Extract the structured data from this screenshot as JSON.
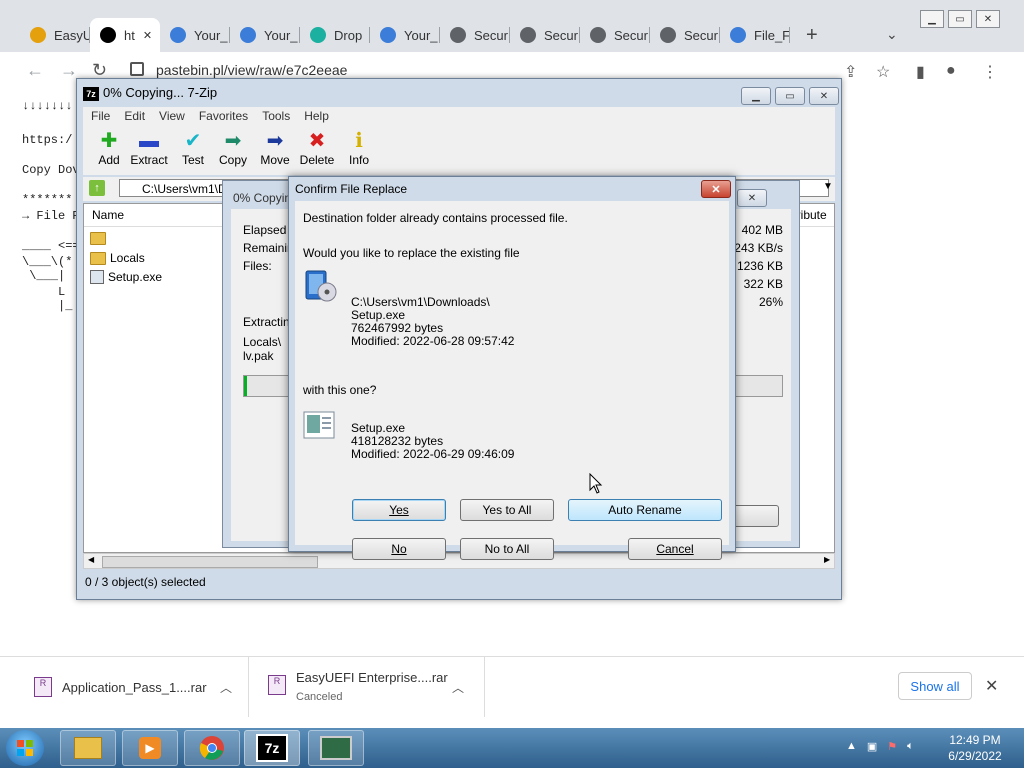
{
  "browser": {
    "tabs": [
      {
        "label": "EasyU",
        "color": "#e5a00d"
      },
      {
        "label": "ht",
        "color": "#000000",
        "active": true
      },
      {
        "label": "Your_",
        "color": "#3b7dd8"
      },
      {
        "label": "Your_",
        "color": "#3b7dd8"
      },
      {
        "label": "Drop",
        "color": "#1bb0a0"
      },
      {
        "label": "Your_",
        "color": "#3b7dd8"
      },
      {
        "label": "Secur",
        "color": "#5f6368"
      },
      {
        "label": "Secur",
        "color": "#5f6368"
      },
      {
        "label": "Secur",
        "color": "#5f6368"
      },
      {
        "label": "Secur",
        "color": "#5f6368"
      },
      {
        "label": "File_F",
        "color": "#3b7dd8"
      }
    ],
    "new_tab_glyph": "+",
    "url": "pastebin.pl/view/raw/e7c2eeae",
    "page_lines": [
      "↓↓↓↓↓↓↓",
      "https:/",
      "Copy Dov",
      "*******",
      "→ File P",
      "____ <==",
      "\\___\\(*",
      " \\___|",
      "     L",
      "     |_"
    ]
  },
  "downloads": [
    {
      "name": "Application_Pass_1....rar",
      "status": ""
    },
    {
      "name": "EasyUEFI Enterprise....rar",
      "status": "Canceled"
    }
  ],
  "show_all_label": "Show all",
  "zip": {
    "title": "0% Copying... 7-Zip",
    "menu": [
      "File",
      "Edit",
      "View",
      "Favorites",
      "Tools",
      "Help"
    ],
    "tools": [
      {
        "label": "Add",
        "glyph": "✚",
        "color": "#1faa1f"
      },
      {
        "label": "Extract",
        "glyph": "▬",
        "color": "#2a47c8"
      },
      {
        "label": "Test",
        "glyph": "✔",
        "color": "#19b5c9"
      },
      {
        "label": "Copy",
        "glyph": "➡",
        "color": "#1f8a6a"
      },
      {
        "label": "Move",
        "glyph": "➡",
        "color": "#1c3a9c"
      },
      {
        "label": "Delete",
        "glyph": "✖",
        "color": "#d81f1f"
      },
      {
        "label": "Info",
        "glyph": "ℹ",
        "color": "#d4b000"
      }
    ],
    "path": "C:\\Users\\vm1\\D",
    "column_name": "Name",
    "column_right": "ttribute",
    "rows": [
      {
        "name": "",
        "kind": "folder"
      },
      {
        "name": "Locals",
        "kind": "folder"
      },
      {
        "name": "Setup.exe",
        "kind": "file"
      }
    ],
    "status": "0 / 3 object(s) selected"
  },
  "progress": {
    "title": "0% Copyin",
    "labels": [
      "Elapsed ti",
      "Remainin",
      "Files:"
    ],
    "values": [
      "402 MB",
      "243 KB/s",
      "1236 KB",
      "322 KB",
      "26%"
    ],
    "extracting_label": "Extracting",
    "extracting_path": [
      "Locals\\",
      "lv.pak"
    ],
    "percent": 0.005
  },
  "confirm": {
    "title": "Confirm File Replace",
    "close_glyph": "✕",
    "line1": "Destination folder already contains processed file.",
    "line2": "Would you like to replace the existing file",
    "existing": {
      "path": "C:\\Users\\vm1\\Downloads\\",
      "name": "Setup.exe",
      "size": "762467992 bytes",
      "modified": "Modified: 2022-06-28 09:57:42"
    },
    "with_label": "with this one?",
    "new": {
      "name": "Setup.exe",
      "size": "418128232 bytes",
      "modified": "Modified: 2022-06-29 09:46:09"
    },
    "buttons": {
      "yes": "Yes",
      "yes_to_all": "Yes to All",
      "auto_rename": "Auto Rename",
      "no": "No",
      "no_to_all": "No to All",
      "cancel": "Cancel"
    }
  },
  "clock": {
    "time": "12:49 PM",
    "date": "6/29/2022"
  }
}
